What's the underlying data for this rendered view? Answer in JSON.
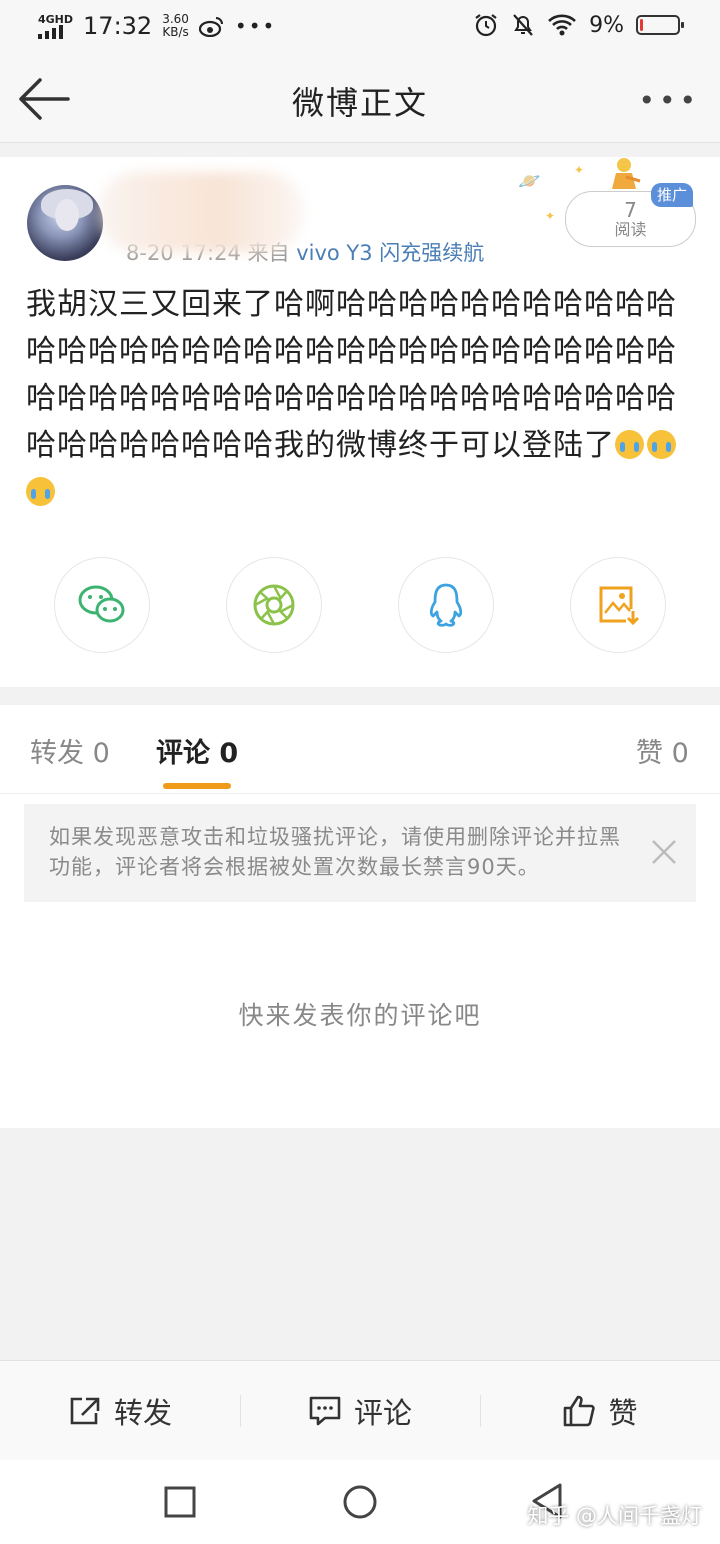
{
  "status_bar": {
    "network": "4GHD",
    "time": "17:32",
    "speed_value": "3.60",
    "speed_unit": "KB/s",
    "battery_percent": "9%",
    "battery_level": 0.09
  },
  "header": {
    "title": "微博正文",
    "more_label": "•••"
  },
  "post": {
    "source_partial": "8-20 17:24 来自",
    "device": "vivo Y3 闪充强续航",
    "read_count": "7",
    "read_label": "阅读",
    "promo_badge": "推广",
    "content": "我胡汉三又回来了哈啊哈哈哈哈哈哈哈哈哈哈哈哈哈哈哈哈哈哈哈哈哈哈哈哈哈哈哈哈哈哈哈哈哈哈哈哈哈哈哈哈哈哈哈哈哈哈哈哈哈哈哈哈哈哈哈哈哈哈哈哈哈我的微博终于可以登陆了",
    "emoji_count": 3
  },
  "share": {
    "icons": [
      "wechat-icon",
      "moments-icon",
      "qq-icon",
      "save-image-icon"
    ]
  },
  "tabs": {
    "repost_label": "转发",
    "repost_count": "0",
    "comment_label": "评论",
    "comment_count": "0",
    "like_label": "赞",
    "like_count": "0"
  },
  "comments": {
    "notice": "如果发现恶意攻击和垃圾骚扰评论，请使用删除评论并拉黑功能，评论者将会根据被处置次数最长禁言90天。",
    "empty_hint": "快来发表你的评论吧"
  },
  "bottom_bar": {
    "repost": "转发",
    "comment": "评论",
    "like": "赞"
  },
  "watermark": "知乎 @人间千盏灯",
  "colors": {
    "accent": "#f09a1a",
    "link": "#4a7eb5",
    "badge": "#5b8fd9",
    "battery_low": "#e53935"
  }
}
